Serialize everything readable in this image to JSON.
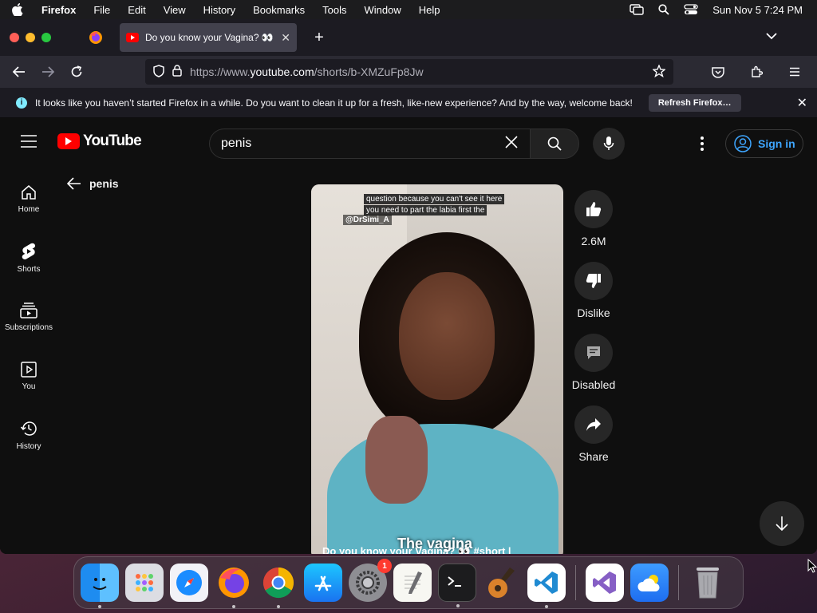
{
  "menubar": {
    "app_name": "Firefox",
    "items": [
      "File",
      "Edit",
      "View",
      "History",
      "Bookmarks",
      "Tools",
      "Window",
      "Help"
    ],
    "clock": "Sun Nov 5  7:24 PM"
  },
  "browser": {
    "tab": {
      "title": "Do you know your Vagina? 👀 #",
      "close": "✕"
    },
    "new_tab": "+",
    "url": {
      "prefix": "https://www.",
      "domain": "youtube.com",
      "path": "/shorts/b-XMZuFp8Jw"
    },
    "notification": {
      "message": "It looks like you haven’t started Firefox in a while. Do you want to clean it up for a fresh, like-new experience? And by the way, welcome back!",
      "button": "Refresh Firefox…",
      "close": "✕"
    }
  },
  "youtube": {
    "logo_text": "YouTube",
    "search_query": "penis",
    "sign_in": "Sign in",
    "guide": [
      {
        "label": "Home",
        "icon": "home-icon"
      },
      {
        "label": "Shorts",
        "icon": "shorts-icon"
      },
      {
        "label": "Subscriptions",
        "icon": "subscriptions-icon"
      },
      {
        "label": "You",
        "icon": "you-icon"
      },
      {
        "label": "History",
        "icon": "history-icon"
      }
    ],
    "back_label": "penis",
    "short": {
      "caption_line1": "question because you can't see it here",
      "caption_line2": "you need to part the labia first the",
      "handle": "@DrSimi_A",
      "overlay_text": "The vagina",
      "title": "Do you know your Vagina? 👀 #short |"
    },
    "actions": {
      "likes": "2.6M",
      "dislike": "Dislike",
      "comments": "Disabled",
      "share": "Share"
    }
  },
  "dock": {
    "apps": [
      "Finder",
      "Launchpad",
      "Safari",
      "Firefox",
      "Chrome",
      "App Store",
      "System Settings",
      "TextEdit",
      "Terminal",
      "GarageBand",
      "Visual Studio Code",
      "Visual Studio",
      "Weather",
      "Trash"
    ],
    "settings_badge": "1"
  },
  "colors": {
    "yt_red": "#ff0000",
    "link_blue": "#3ea6ff",
    "bg": "#0f0f0f"
  }
}
